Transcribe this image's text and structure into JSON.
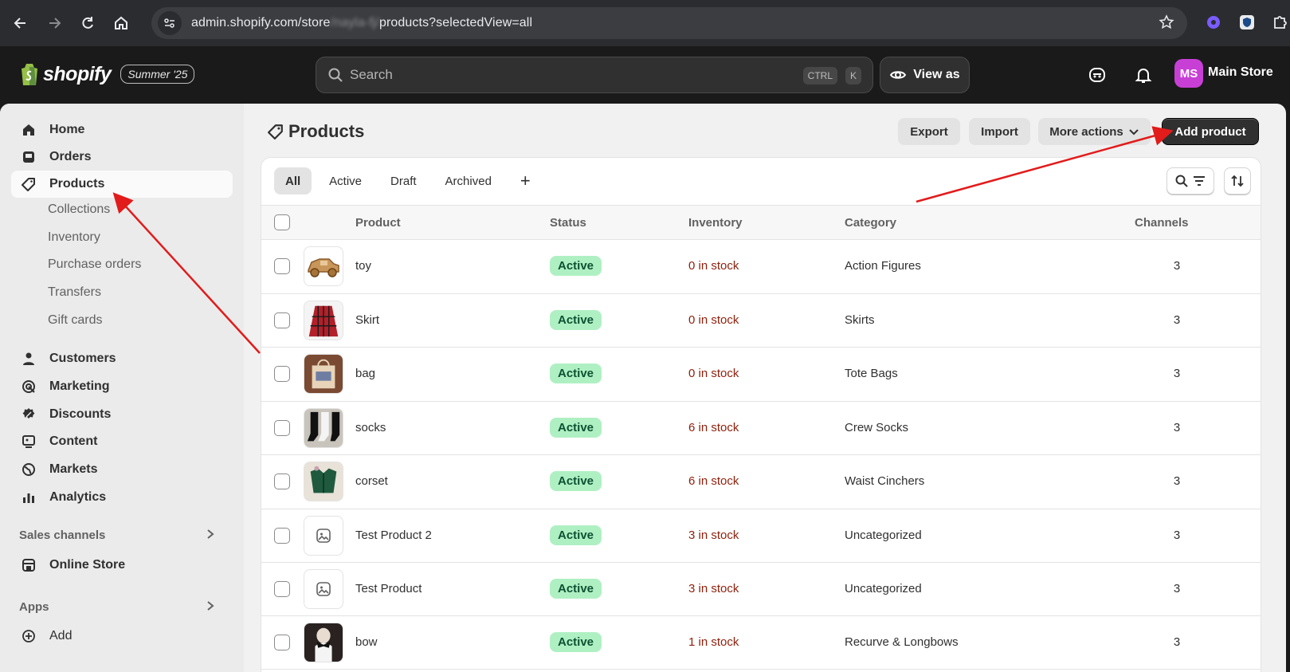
{
  "browser": {
    "url_prefix": "admin.shopify.com/store",
    "url_redacted": "/nayla-fj/",
    "url_suffix": "products?selectedView=all"
  },
  "header": {
    "brand": "shopify",
    "edition": "Summer '25",
    "search_placeholder": "Search",
    "kbd_ctrl": "CTRL",
    "kbd_k": "K",
    "view_as": "View as",
    "avatar_initials": "MS",
    "store_name": "Main Store"
  },
  "sidebar": {
    "items": [
      {
        "label": "Home",
        "icon": "home-icon"
      },
      {
        "label": "Orders",
        "icon": "inbox-icon"
      },
      {
        "label": "Products",
        "icon": "tag-icon"
      }
    ],
    "product_sub": [
      "Collections",
      "Inventory",
      "Purchase orders",
      "Transfers",
      "Gift cards"
    ],
    "items2": [
      {
        "label": "Customers",
        "icon": "person-icon"
      },
      {
        "label": "Marketing",
        "icon": "target-icon"
      },
      {
        "label": "Discounts",
        "icon": "discount-icon"
      },
      {
        "label": "Content",
        "icon": "content-icon"
      },
      {
        "label": "Markets",
        "icon": "globe-icon"
      },
      {
        "label": "Analytics",
        "icon": "bar-chart-icon"
      }
    ],
    "sales_channels": "Sales channels",
    "online_store": "Online Store",
    "apps": "Apps",
    "add": "Add"
  },
  "page": {
    "title": "Products",
    "export": "Export",
    "import": "Import",
    "more_actions": "More actions",
    "add_product": "Add product"
  },
  "tabs": [
    "All",
    "Active",
    "Draft",
    "Archived"
  ],
  "table": {
    "headers": {
      "product": "Product",
      "status": "Status",
      "inventory": "Inventory",
      "category": "Category",
      "channels": "Channels"
    },
    "rows": [
      {
        "name": "toy",
        "status": "Active",
        "inventory": "0 in stock",
        "category": "Action Figures",
        "channels": "3",
        "thumb": "toy-car"
      },
      {
        "name": "Skirt",
        "status": "Active",
        "inventory": "0 in stock",
        "category": "Skirts",
        "channels": "3",
        "thumb": "skirt"
      },
      {
        "name": "bag",
        "status": "Active",
        "inventory": "0 in stock",
        "category": "Tote Bags",
        "channels": "3",
        "thumb": "bag"
      },
      {
        "name": "socks",
        "status": "Active",
        "inventory": "6 in stock",
        "category": "Crew Socks",
        "channels": "3",
        "thumb": "socks"
      },
      {
        "name": "corset",
        "status": "Active",
        "inventory": "6 in stock",
        "category": "Waist Cinchers",
        "channels": "3",
        "thumb": "corset"
      },
      {
        "name": "Test Product 2",
        "status": "Active",
        "inventory": "3 in stock",
        "category": "Uncategorized",
        "channels": "3",
        "thumb": "placeholder"
      },
      {
        "name": "Test Product",
        "status": "Active",
        "inventory": "3 in stock",
        "category": "Uncategorized",
        "channels": "3",
        "thumb": "placeholder"
      },
      {
        "name": "bow",
        "status": "Active",
        "inventory": "1 in stock",
        "category": "Recurve & Longbows",
        "channels": "3",
        "thumb": "bow"
      }
    ]
  },
  "colors": {
    "annotation_arrow": "#e21b1b",
    "badge_bg": "#aff0c3",
    "stock_text": "#8e1f0b",
    "avatar": "#c83fd6"
  }
}
